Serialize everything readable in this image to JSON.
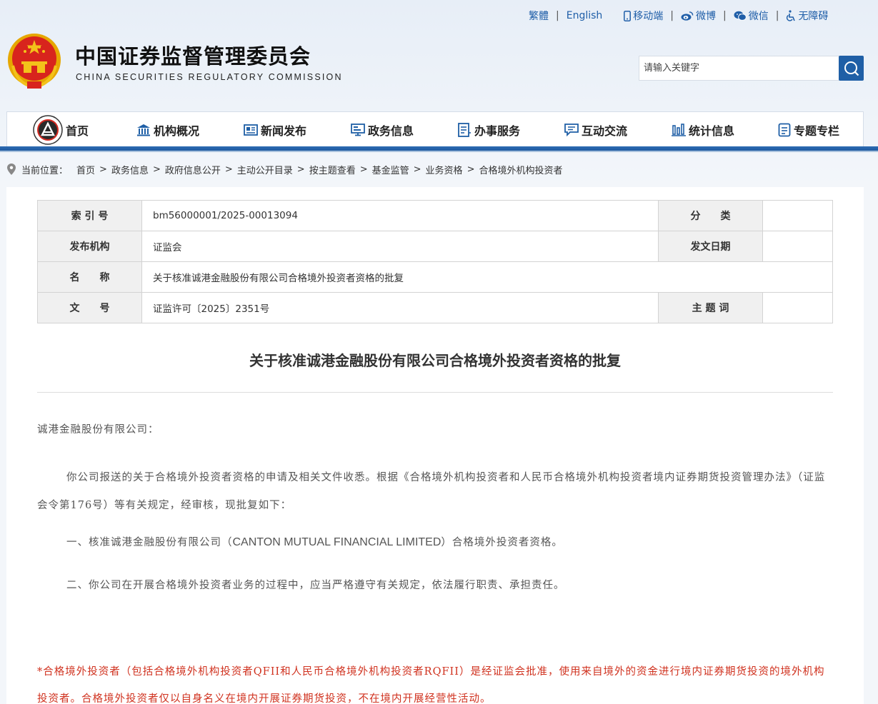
{
  "header": {
    "lang_traditional": "繁體",
    "lang_english": "English",
    "mobile": "移动端",
    "weibo": "微博",
    "wechat": "微信",
    "accessibility": "无障碍",
    "site_title": "中国证券监督管理委员会",
    "site_subtitle": "CHINA SECURITIES REGULATORY COMMISSION",
    "search_placeholder": "请输入关键字"
  },
  "nav": {
    "items": [
      {
        "label": "首页",
        "icon": "home-logo"
      },
      {
        "label": "机构概况",
        "icon": "building-icon"
      },
      {
        "label": "新闻发布",
        "icon": "newspaper-icon"
      },
      {
        "label": "政务信息",
        "icon": "monitor-icon"
      },
      {
        "label": "办事服务",
        "icon": "list-icon"
      },
      {
        "label": "互动交流",
        "icon": "chat-icon"
      },
      {
        "label": "统计信息",
        "icon": "bar-chart-icon"
      },
      {
        "label": "专题专栏",
        "icon": "document-icon"
      }
    ]
  },
  "breadcrumb": {
    "label": "当前位置：",
    "items": [
      "首页",
      "政务信息",
      "政府信息公开",
      "主动公开目录",
      "按主题查看",
      "基金监管",
      "业务资格",
      "合格境外机构投资者"
    ],
    "separator": ">"
  },
  "meta": {
    "index_label": "索 引 号",
    "index_value": "bm56000001/2025-00013094",
    "category_label": "分　　类",
    "category_value": "",
    "publisher_label": "发布机构",
    "publisher_value": "证监会",
    "date_label": "发文日期",
    "date_value": "",
    "name_label": "名　　称",
    "name_value": "关于核准诚港金融股份有限公司合格境外投资者资格的批复",
    "docno_label": "文　　号",
    "docno_value": "证监许可〔2025〕2351号",
    "keywords_label": "主 题 词",
    "keywords_value": ""
  },
  "document": {
    "title": "关于核准诚港金融股份有限公司合格境外投资者资格的批复",
    "salutation": "诚港金融股份有限公司：",
    "p1": "你公司报送的关于合格境外投资者资格的申请及相关文件收悉。根据《合格境外机构投资者和人民币合格境外机构投资者境内证券期货投资管理办法》（证监会令第176号）等有关规定，经审核，现批复如下：",
    "p2_before": "一、核准诚港金融股份有限公司（",
    "p2_latin": "CANTON MUTUAL FINANCIAL LIMITED",
    "p2_after": "）合格境外投资者资格。",
    "p3": "二、你公司在开展合格境外投资者业务的过程中，应当严格遵守有关规定，依法履行职责、承担责任。",
    "note": "*合格境外投资者（包括合格境外机构投资者QFII和人民币合格境外机构投资者RQFII）是经证监会批准，使用来自境外的资金进行境内证券期货投资的境外机构投资者。合格境外投资者仅以自身名义在境内开展证券期货投资，不在境内开展经营性活动。"
  },
  "colors": {
    "brand_blue": "#1f5fa6",
    "note_red": "#d0321f"
  }
}
